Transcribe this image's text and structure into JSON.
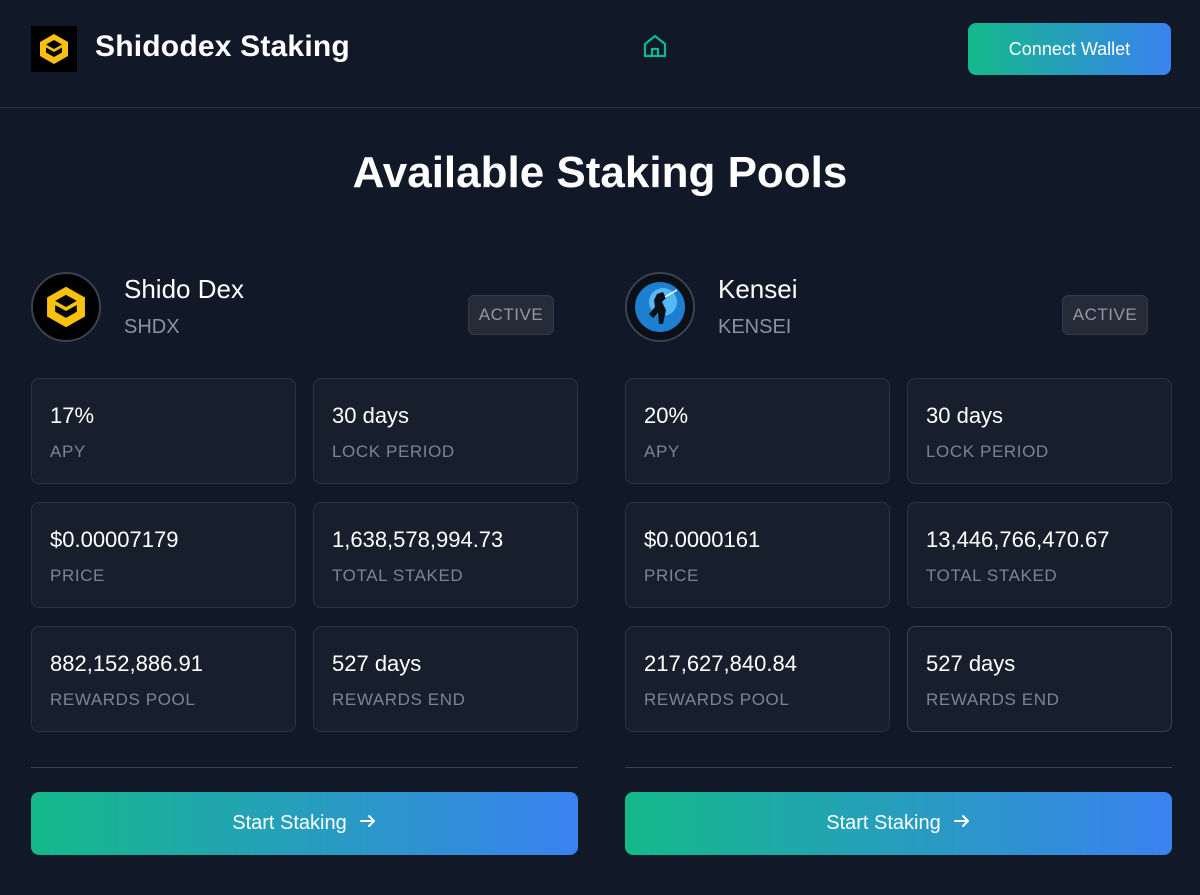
{
  "header": {
    "title": "Shidodex Staking",
    "connect_label": "Connect Wallet",
    "logo_icon": "shidodex-logo-icon",
    "home_icon": "home-icon"
  },
  "page_title": "Available Staking Pools",
  "colors": {
    "background": "#111827",
    "card": "#181f2c",
    "accent_start": "#13b98a",
    "accent_end": "#3a82f0",
    "logo_yellow": "#f7c10e"
  },
  "pools": [
    {
      "name": "Shido Dex",
      "symbol": "SHDX",
      "status": "ACTIVE",
      "apy": "17%",
      "apy_label": "APY",
      "lock_period": "30 days",
      "lock_label": "LOCK PERIOD",
      "price": "$0.00007179",
      "price_label": "PRICE",
      "total_staked": "1,638,578,994.73",
      "total_staked_label": "TOTAL STAKED",
      "rewards_pool": "882,152,886.91",
      "rewards_pool_label": "REWARDS POOL",
      "rewards_end": "527 days",
      "rewards_end_label": "REWARDS END",
      "button_label": "Start Staking",
      "icon": "shidodex-logo-icon"
    },
    {
      "name": "Kensei",
      "symbol": "KENSEI",
      "status": "ACTIVE",
      "apy": "20%",
      "apy_label": "APY",
      "lock_period": "30 days",
      "lock_label": "LOCK PERIOD",
      "price": "$0.0000161",
      "price_label": "PRICE",
      "total_staked": "13,446,766,470.67",
      "total_staked_label": "TOTAL STAKED",
      "rewards_pool": "217,627,840.84",
      "rewards_pool_label": "REWARDS POOL",
      "rewards_end": "527 days",
      "rewards_end_label": "REWARDS END",
      "button_label": "Start Staking",
      "icon": "kensei-samurai-icon"
    }
  ]
}
